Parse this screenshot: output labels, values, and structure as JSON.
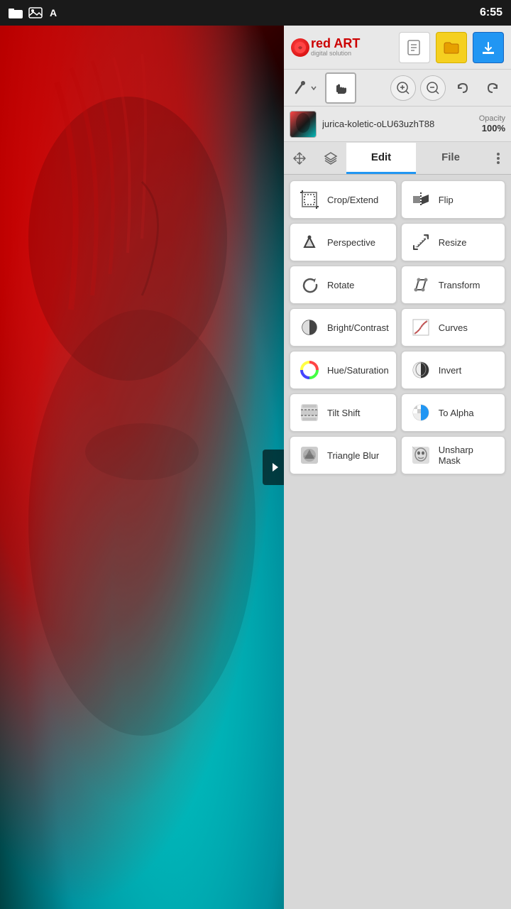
{
  "statusBar": {
    "time": "6:55",
    "icons": [
      "folder",
      "image",
      "font"
    ]
  },
  "header": {
    "logoText": "red ART",
    "logoSub": "digital solution",
    "newLabel": "□",
    "folderLabel": "📁",
    "downloadLabel": "⬇"
  },
  "toolbar": {
    "brushActive": false,
    "handActive": true,
    "zoomIn": "+",
    "zoomOut": "−",
    "undo": "↩",
    "redo": "↪"
  },
  "layer": {
    "name": "jurica-koletic-oLU63uzhT88",
    "opacity": "Opacity",
    "opacityValue": "100%"
  },
  "tabs": {
    "edit": "Edit",
    "file": "File"
  },
  "tools": [
    {
      "id": "crop-extend",
      "label": "Crop/Extend",
      "icon": "crop"
    },
    {
      "id": "flip",
      "label": "Flip",
      "icon": "flip"
    },
    {
      "id": "perspective",
      "label": "Perspective",
      "icon": "perspective"
    },
    {
      "id": "resize",
      "label": "Resize",
      "icon": "resize"
    },
    {
      "id": "rotate",
      "label": "Rotate",
      "icon": "rotate"
    },
    {
      "id": "transform",
      "label": "Transform",
      "icon": "transform"
    },
    {
      "id": "bright-contrast",
      "label": "Bright/Contrast",
      "icon": "bright"
    },
    {
      "id": "curves",
      "label": "Curves",
      "icon": "curves"
    },
    {
      "id": "hue-saturation",
      "label": "Hue/Saturation",
      "icon": "hue"
    },
    {
      "id": "invert",
      "label": "Invert",
      "icon": "invert"
    },
    {
      "id": "tilt-shift",
      "label": "Tilt Shift",
      "icon": "tiltshift"
    },
    {
      "id": "to-alpha",
      "label": "To Alpha",
      "icon": "toalpha"
    },
    {
      "id": "triangle-blur",
      "label": "Triangle Blur",
      "icon": "triangleblur"
    },
    {
      "id": "unsharp-mask",
      "label": "Unsharp Mask",
      "icon": "unsharpmask"
    }
  ]
}
